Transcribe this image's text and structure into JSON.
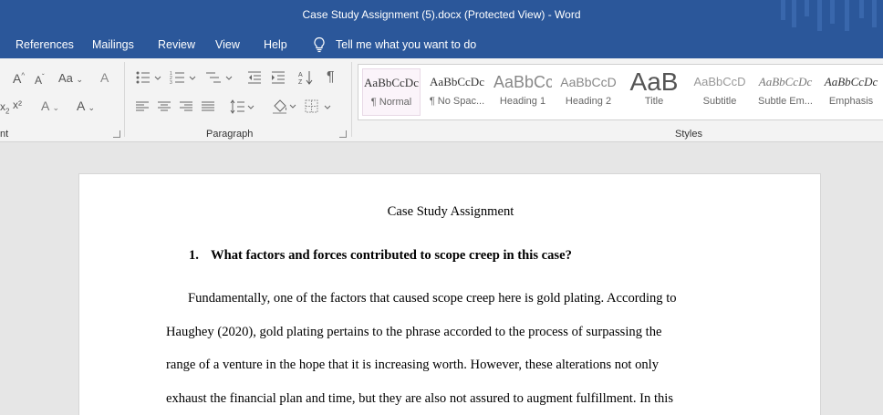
{
  "window": {
    "title": "Case Study Assignment (5).docx (Protected View)  -  Word"
  },
  "tabs": [
    {
      "label": "References"
    },
    {
      "label": "Mailings"
    },
    {
      "label": "Review"
    },
    {
      "label": "View"
    },
    {
      "label": "Help"
    }
  ],
  "tell_me": {
    "label": "Tell me what you want to do"
  },
  "ribbon": {
    "font_group_label": "nt",
    "paragraph_group_label": "Paragraph",
    "styles_group_label": "Styles",
    "font_buttons": {
      "grow": "A",
      "shrink": "A",
      "case": "Aa",
      "clear": "A",
      "sub": "x",
      "sup": "x²",
      "effects": "A",
      "color": "A"
    },
    "styles": [
      {
        "preview": "AaBbCcDc",
        "name": "¶ Normal"
      },
      {
        "preview": "AaBbCcDc",
        "name": "¶ No Spac..."
      },
      {
        "preview": "AaBbCc",
        "name": "Heading 1"
      },
      {
        "preview": "AaBbCcD",
        "name": "Heading 2"
      },
      {
        "preview": "AaB",
        "name": "Title"
      },
      {
        "preview": "AaBbCcD",
        "name": "Subtitle"
      },
      {
        "preview": "AaBbCcDc",
        "name": "Subtle Em..."
      },
      {
        "preview": "AaBbCcDc",
        "name": "Emphasis"
      }
    ]
  },
  "document": {
    "title": "Case Study Assignment",
    "question_number": "1.",
    "question_text": "What factors and forces contributed to scope creep in this case?",
    "lines": [
      "Fundamentally, one of the factors that caused scope creep here is gold plating. According to",
      "Haughey (2020), gold plating pertains to the phrase accorded to the process of surpassing the",
      "range of a venture in the hope that it is increasing worth. However, these alterations not only",
      "exhaust the financial plan and time, but they are also not assured to augment fulfillment. In this"
    ]
  }
}
